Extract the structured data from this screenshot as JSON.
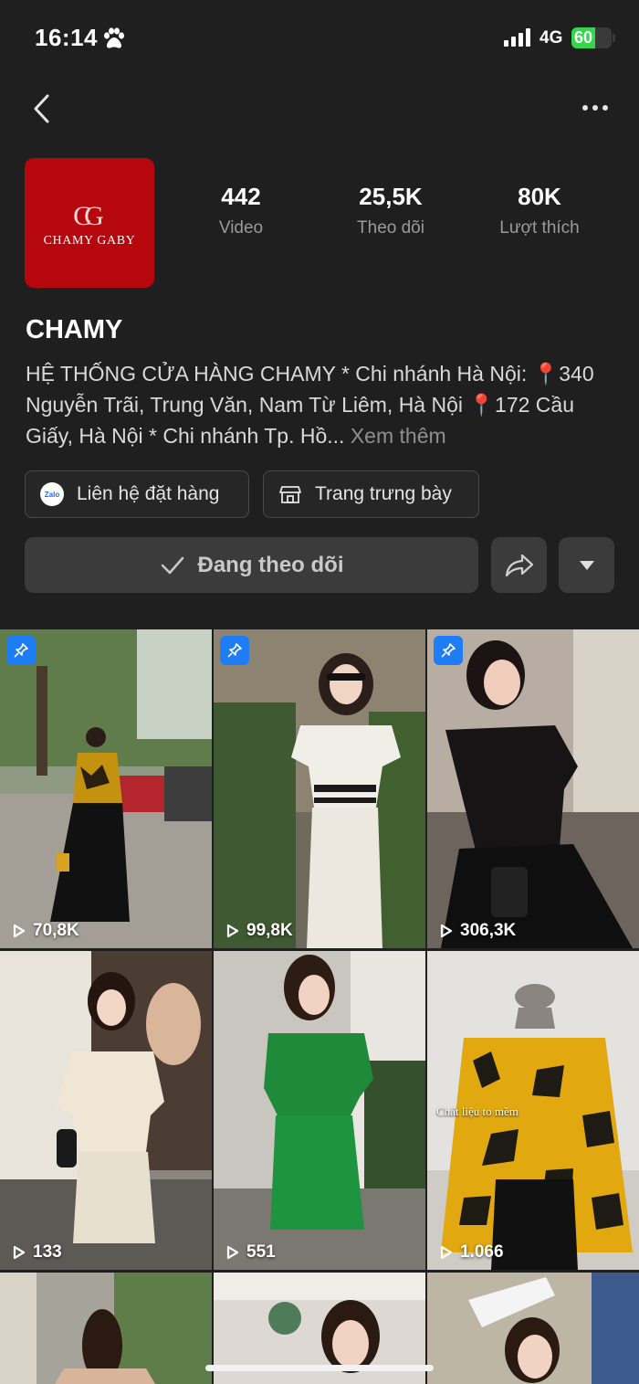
{
  "status_bar": {
    "time": "16:14",
    "network": "4G",
    "battery": "60",
    "battery_level": 0.6,
    "icons": [
      "paw-icon",
      "signal-icon",
      "battery-charging-icon"
    ]
  },
  "header": {
    "back_icon": "chevron-left-icon",
    "more_icon": "more-horizontal-icon"
  },
  "profile": {
    "avatar": {
      "logo_mark": "CG",
      "logo_text": "CHAMY GABY"
    },
    "stats": [
      {
        "value": "442",
        "label": "Video"
      },
      {
        "value": "25,5K",
        "label": "Theo dõi"
      },
      {
        "value": "80K",
        "label": "Lượt thích"
      }
    ],
    "name": "CHAMY",
    "bio": "HỆ THỐNG CỬA HÀNG CHAMY * Chi nhánh Hà Nội: 📍340 Nguyễn Trãi, Trung Văn, Nam Từ Liêm, Hà Nội 📍172 Cầu Giấy, Hà Nội * Chi nhánh Tp. Hồ...",
    "see_more": "Xem thêm",
    "chips": [
      {
        "label": "Liên hệ đặt hàng",
        "icon": "zalo-icon",
        "icon_text": "Zalo"
      },
      {
        "label": "Trang trưng bày",
        "icon": "store-icon"
      }
    ],
    "follow_button": "Đang theo dõi",
    "accent_colors": {
      "brand": "#b6060e",
      "pin": "#1e7cf5"
    }
  },
  "videos": [
    {
      "views": "70,8K",
      "pinned": true
    },
    {
      "views": "99,8K",
      "pinned": true
    },
    {
      "views": "306,3K",
      "pinned": true
    },
    {
      "views": "133",
      "pinned": false
    },
    {
      "views": "551",
      "pinned": false
    },
    {
      "views": "1.066",
      "pinned": false,
      "overlay_text": "Chất liệu to mềm"
    },
    {
      "views": "",
      "pinned": false
    },
    {
      "views": "",
      "pinned": false
    },
    {
      "views": "",
      "pinned": false
    }
  ]
}
